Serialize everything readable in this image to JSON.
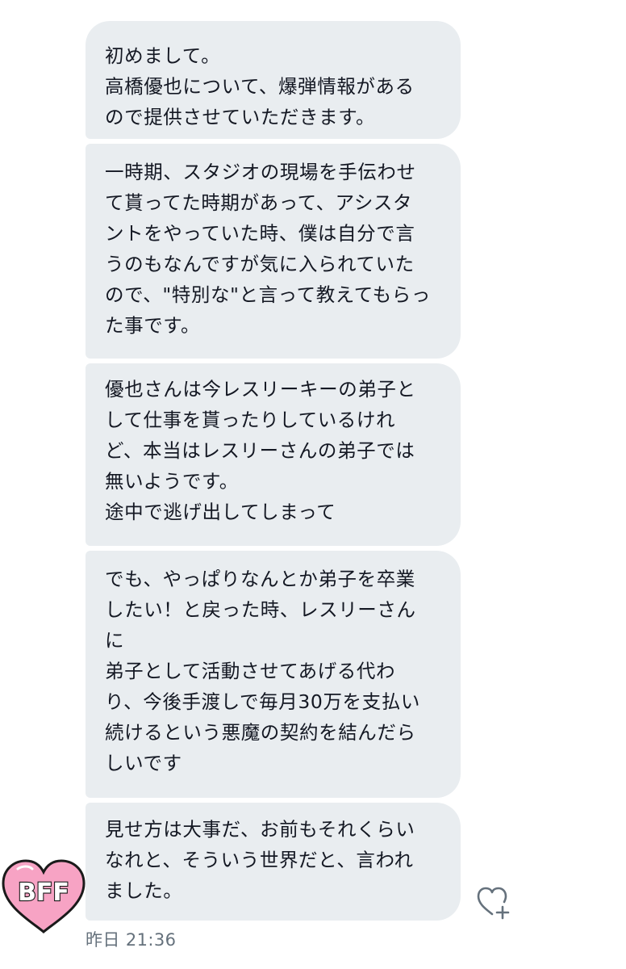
{
  "messages": [
    {
      "text": "初めまして。\n高橋優也について、爆弾情報がある\nので提供させていただきます。"
    },
    {
      "text": "一時期、スタジオの現場を手伝わせ\nて貰ってた時期があって、アシスタ\nントをやっていた時、僕は自分で言\nうのもなんですが気に入られていた\nので、\"特別な\"と言って教えてもらっ\nた事です。"
    },
    {
      "text": "優也さんは今レスリーキーの弟子と\nして仕事を貰ったりしているけれ\nど、本当はレスリーさんの弟子では\n無いようです。\n途中で逃げ出してしまって"
    },
    {
      "text": "でも、やっぱりなんとか弟子を卒業\nしたい！と戻った時、レスリーさん\nに\n弟子として活動させてあげる代わ\nり、今後手渡しで毎月30万を支払い\n続けるという悪魔の契約を結んだら\nしいです"
    },
    {
      "text": "見せ方は大事だ、お前もそれくらい\nなれと、そういう世界だと、言われ\nました。"
    }
  ],
  "avatar": {
    "label": "BFF",
    "heart_color": "#f7a3c4",
    "text_color": "#ffffff",
    "outline_color": "#1a1a1a"
  },
  "timestamp": "昨日 21:36",
  "icons": {
    "like": "heart-plus-icon"
  },
  "colors": {
    "bubble": "#e9edf0",
    "text": "#141823",
    "meta": "#65717c"
  }
}
